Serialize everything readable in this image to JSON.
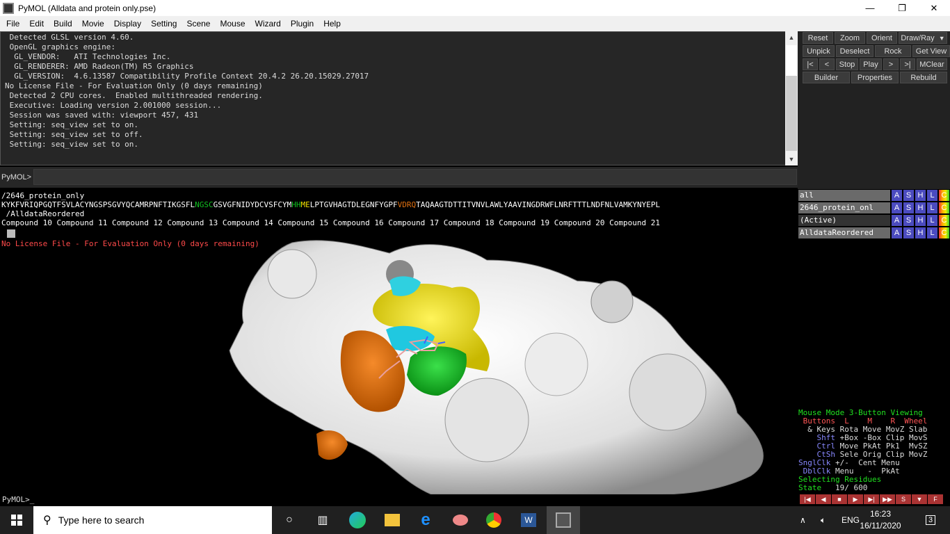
{
  "window": {
    "title": "PyMOL (Alldata and protein only.pse)",
    "minimize": "—",
    "maximize": "❐",
    "close": "✕"
  },
  "menu": [
    "File",
    "Edit",
    "Build",
    "Movie",
    "Display",
    "Setting",
    "Scene",
    "Mouse",
    "Wizard",
    "Plugin",
    "Help"
  ],
  "console": {
    "lines": [
      " Detected GLSL version 4.60.",
      " OpenGL graphics engine:",
      "  GL_VENDOR:   ATI Technologies Inc.",
      "  GL_RENDERER: AMD Radeon(TM) R5 Graphics",
      "  GL_VERSION:  4.6.13587 Compatibility Profile Context 20.4.2 26.20.15029.27017",
      "No License File - For Evaluation Only (0 days remaining)",
      " Detected 2 CPU cores.  Enabled multithreaded rendering.",
      " Executive: Loading version 2.001000 session...",
      " Session was saved with: viewport 457, 431",
      " Setting: seq_view set to on.",
      " Setting: seq_view set to off.",
      " Setting: seq_view set to on."
    ],
    "prompt": "PyMOL>",
    "input_value": ""
  },
  "buttons": {
    "row1": [
      "Reset",
      "Zoom",
      "Orient",
      "Draw/Ray"
    ],
    "row2": [
      "Unpick",
      "Deselect",
      "Rock",
      "Get View"
    ],
    "row3": [
      "|<",
      "<",
      "Stop",
      "Play",
      ">",
      ">|",
      "MClear"
    ],
    "row4": [
      "Builder",
      "Properties",
      "Rebuild"
    ]
  },
  "sequence": {
    "obj1": "/2646_protein_only",
    "seq_a": "KYKFVRIQPGQTFSVLACYNGSPSGVYQCAMRPNFTIKGSFL",
    "seq_b": "NGSC",
    "seq_c": "GSVGFNIDYDCVSFCYM",
    "seq_d": "HH",
    "seq_e": "ME",
    "seq_f": "LPTGVHAGTDLEGNFYGPF",
    "seq_g": "VDRQ",
    "seq_h": "TAQAAGTDTTITVNVLAWLYAAVINGDRWFLNRFTTTLNDFNLVAMKYNYEPL",
    "obj2": " /AlldataReordered",
    "compounds": "Compound 10 Compound 11 Compound 12 Compound 13 Compound 14 Compound 15 Compound 16 Compound 17 Compound 18 Compound 19 Compound 20 Compound 21"
  },
  "objects": [
    {
      "name": "all",
      "flags": [
        "A",
        "S",
        "H",
        "L",
        "C"
      ]
    },
    {
      "name": "2646_protein_onl",
      "flags": [
        "A",
        "S",
        "H",
        "L",
        "C"
      ]
    },
    {
      "name": "(Active)",
      "flags": [
        "A",
        "S",
        "H",
        "L",
        "C"
      ]
    },
    {
      "name": "AlldataReordered",
      "flags": [
        "A",
        "S",
        "H",
        "L",
        "C"
      ]
    }
  ],
  "viewport": {
    "warning": "No License File - For Evaluation Only (0 days remaining)"
  },
  "mouse_panel": {
    "l1": "Mouse Mode 3-Button Viewing",
    "l2a": " Buttons  L    M    R  Wheel",
    "l3": "  & Keys Rota Move MovZ Slab",
    "l4a": "    Shft",
    "l4b": " +Box -Box Clip MovS",
    "l5a": "    Ctrl",
    "l5b": " Move PkAt Pk1  MvSZ",
    "l6a": "    CtSh",
    "l6b": " Sele Orig Clip MovZ",
    "l7a": "SnglClk",
    "l7b": " +/-  Cent Menu",
    "l8a": " DblClk",
    "l8b": " Menu   -  PkAt",
    "l9": "Selecting Residues",
    "l10a": "State",
    "l10b": "   19/ 600"
  },
  "movie_controls": [
    "|◀",
    "◀",
    "■",
    "▶",
    "▶|",
    "▶▶",
    "S",
    "▼",
    "F"
  ],
  "prompt2": "PyMOL>_",
  "taskbar": {
    "search_placeholder": "Type here to search",
    "lang": "ENG",
    "time": "16:23",
    "date": "16/11/2020",
    "notifications": "3"
  },
  "colors": {
    "yellow": "#f0e000",
    "orange": "#e07010",
    "green": "#10c020",
    "cyan": "#20d0e0"
  }
}
